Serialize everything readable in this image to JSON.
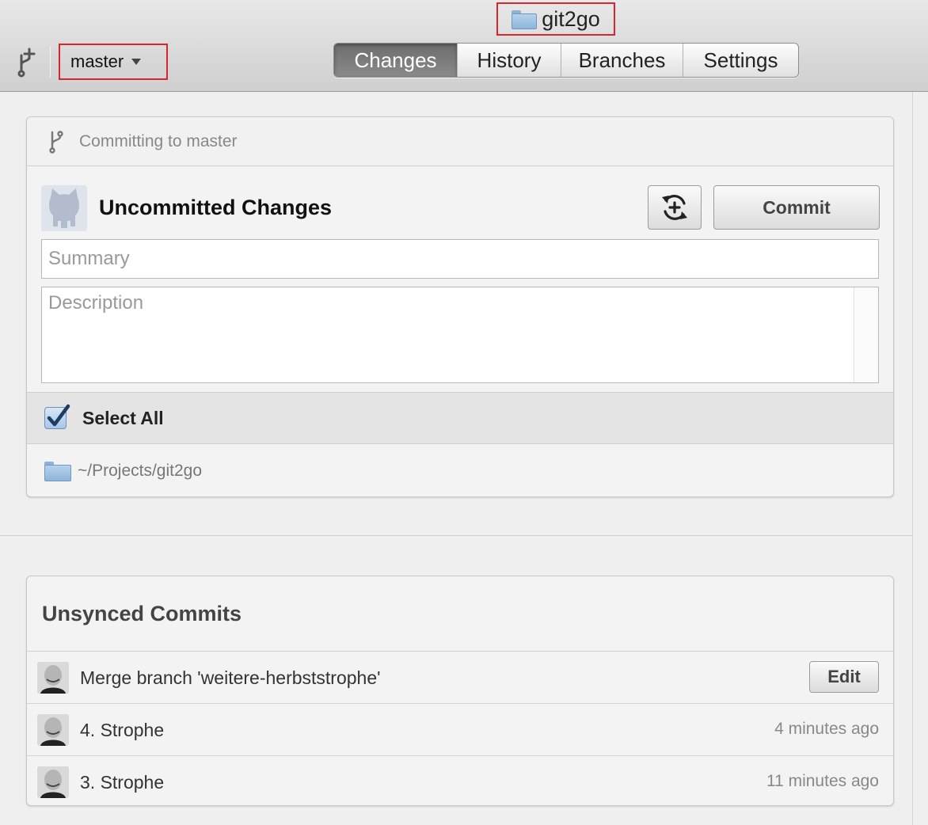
{
  "window": {
    "title": "git2go"
  },
  "toolbar": {
    "branch": "master",
    "tabs": [
      {
        "label": "Changes",
        "active": true
      },
      {
        "label": "History",
        "active": false
      },
      {
        "label": "Branches",
        "active": false
      },
      {
        "label": "Settings",
        "active": false
      }
    ]
  },
  "commit_panel": {
    "header": "Committing to master",
    "title": "Uncommitted Changes",
    "commit_label": "Commit",
    "summary_placeholder": "Summary",
    "description_placeholder": "Description",
    "select_all_label": "Select All",
    "select_all_checked": true,
    "path": "~/Projects/git2go"
  },
  "unsynced": {
    "title": "Unsynced Commits",
    "commits": [
      {
        "message": "Merge branch 'weitere-herbststrophe'",
        "action": "Edit",
        "time": ""
      },
      {
        "message": "4. Strophe",
        "action": "",
        "time": "4 minutes ago"
      },
      {
        "message": "3. Strophe",
        "action": "",
        "time": "11 minutes ago"
      }
    ]
  },
  "colors": {
    "highlight_border": "#d8262d",
    "check": "#1f3c66",
    "active_tab": "#7a7a7a"
  }
}
